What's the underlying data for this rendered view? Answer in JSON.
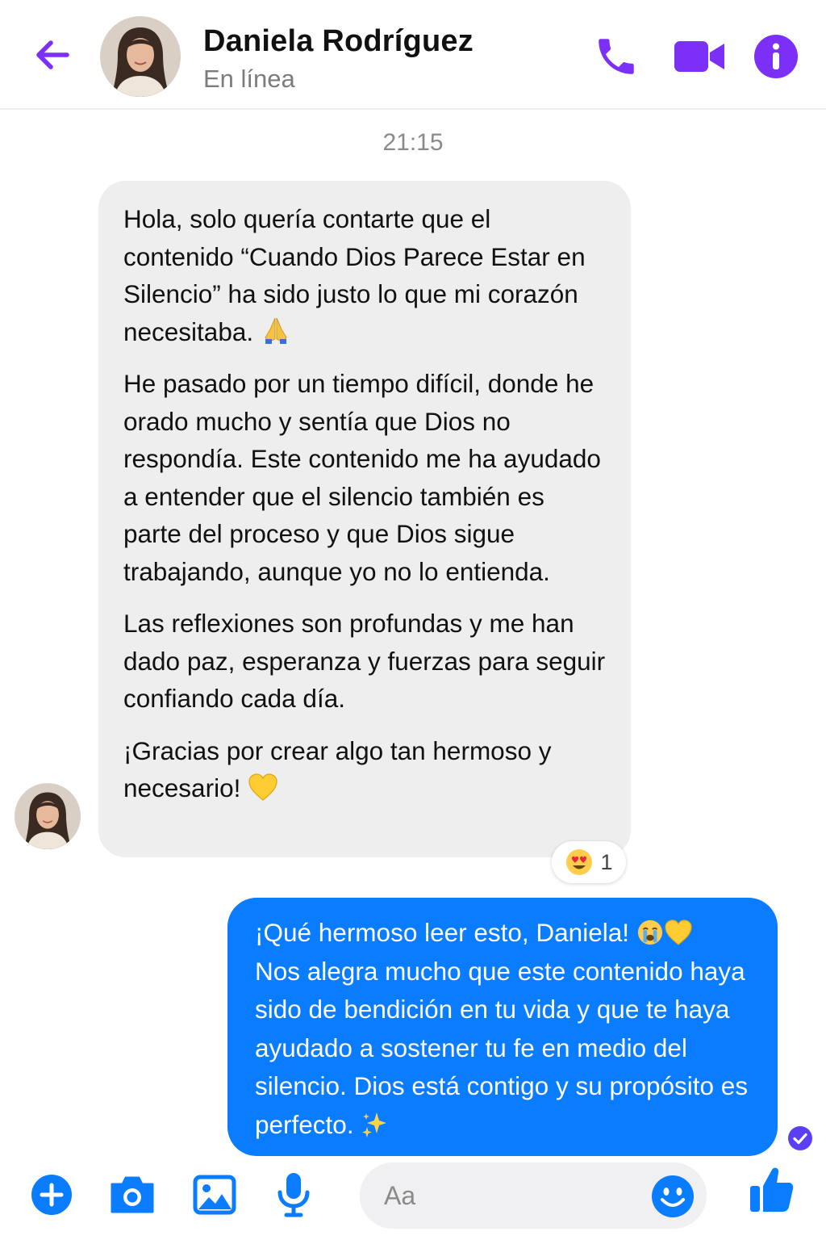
{
  "header": {
    "contact_name": "Daniela Rodríguez",
    "status": "En línea",
    "accent_color": "#7b2ff7"
  },
  "conversation": {
    "timestamp": "21:15",
    "incoming": {
      "paragraphs": [
        "Hola, solo quería contarte que el contenido “Cuando Dios Parece Estar en Silencio” ha sido justo lo que mi corazón necesitaba.",
        "He pasado por un tiempo difícil, donde he orado mucho y sentía que Dios no respondía. Este contenido me ha ayudado a entender que el silencio también es parte del proceso y que Dios sigue trabajando, aunque yo no lo entienda.",
        "Las reflexiones son profundas y me han dado paz, esperanza y fuerzas para seguir confiando cada día.",
        "¡Gracias por crear algo tan hermoso y necesario!"
      ],
      "bubble_color": "#eeeeef",
      "reaction": {
        "emoji": "heart-eyes-emoji",
        "count": "1"
      }
    },
    "outgoing": {
      "line1": "¡Qué hermoso leer esto, Daniela!",
      "line2": "Nos alegra mucho que este contenido haya sido de bendición en tu vida y que te haya ayudado a sostener tu fe en medio del silencio. Dios está contigo y su propósito es perfecto.",
      "bubble_color": "#0a7cff",
      "status": "seen"
    }
  },
  "composer": {
    "placeholder": "Aa",
    "value": "",
    "icon_color": "#0a7cff"
  }
}
